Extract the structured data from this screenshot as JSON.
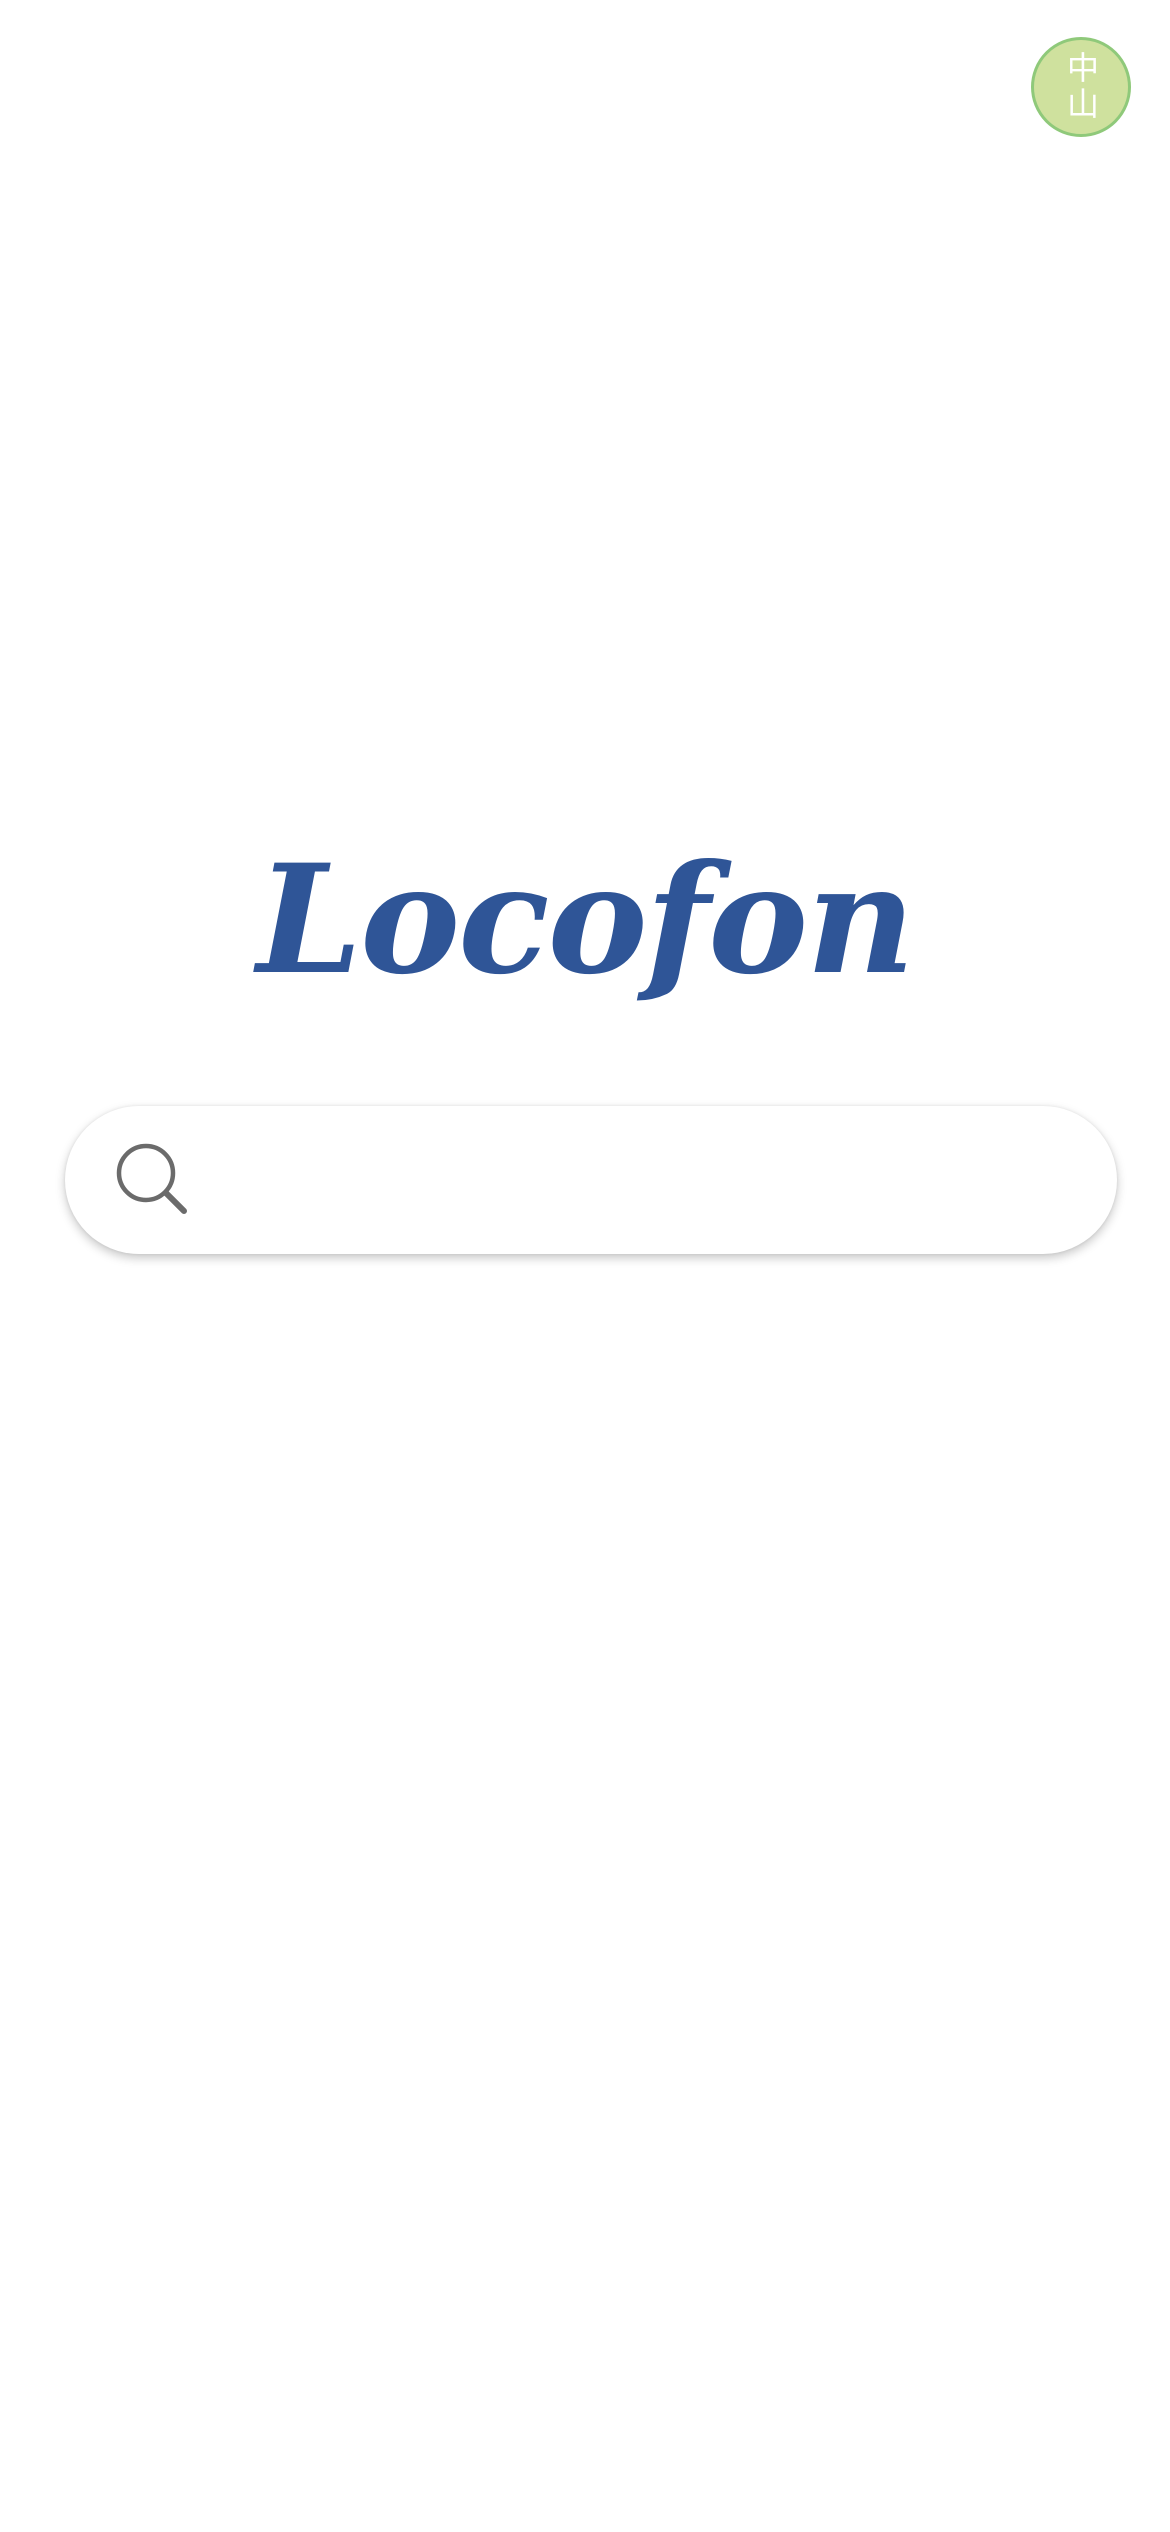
{
  "header": {
    "avatar_text": "中山"
  },
  "logo": {
    "text": "Locofon",
    "color": "#2f5597"
  },
  "search": {
    "placeholder": "",
    "value": "",
    "icon": "search-icon"
  },
  "colors": {
    "avatar_fill": "#cfe19e",
    "avatar_border": "#8fc97a",
    "icon": "#6b6b6b"
  }
}
